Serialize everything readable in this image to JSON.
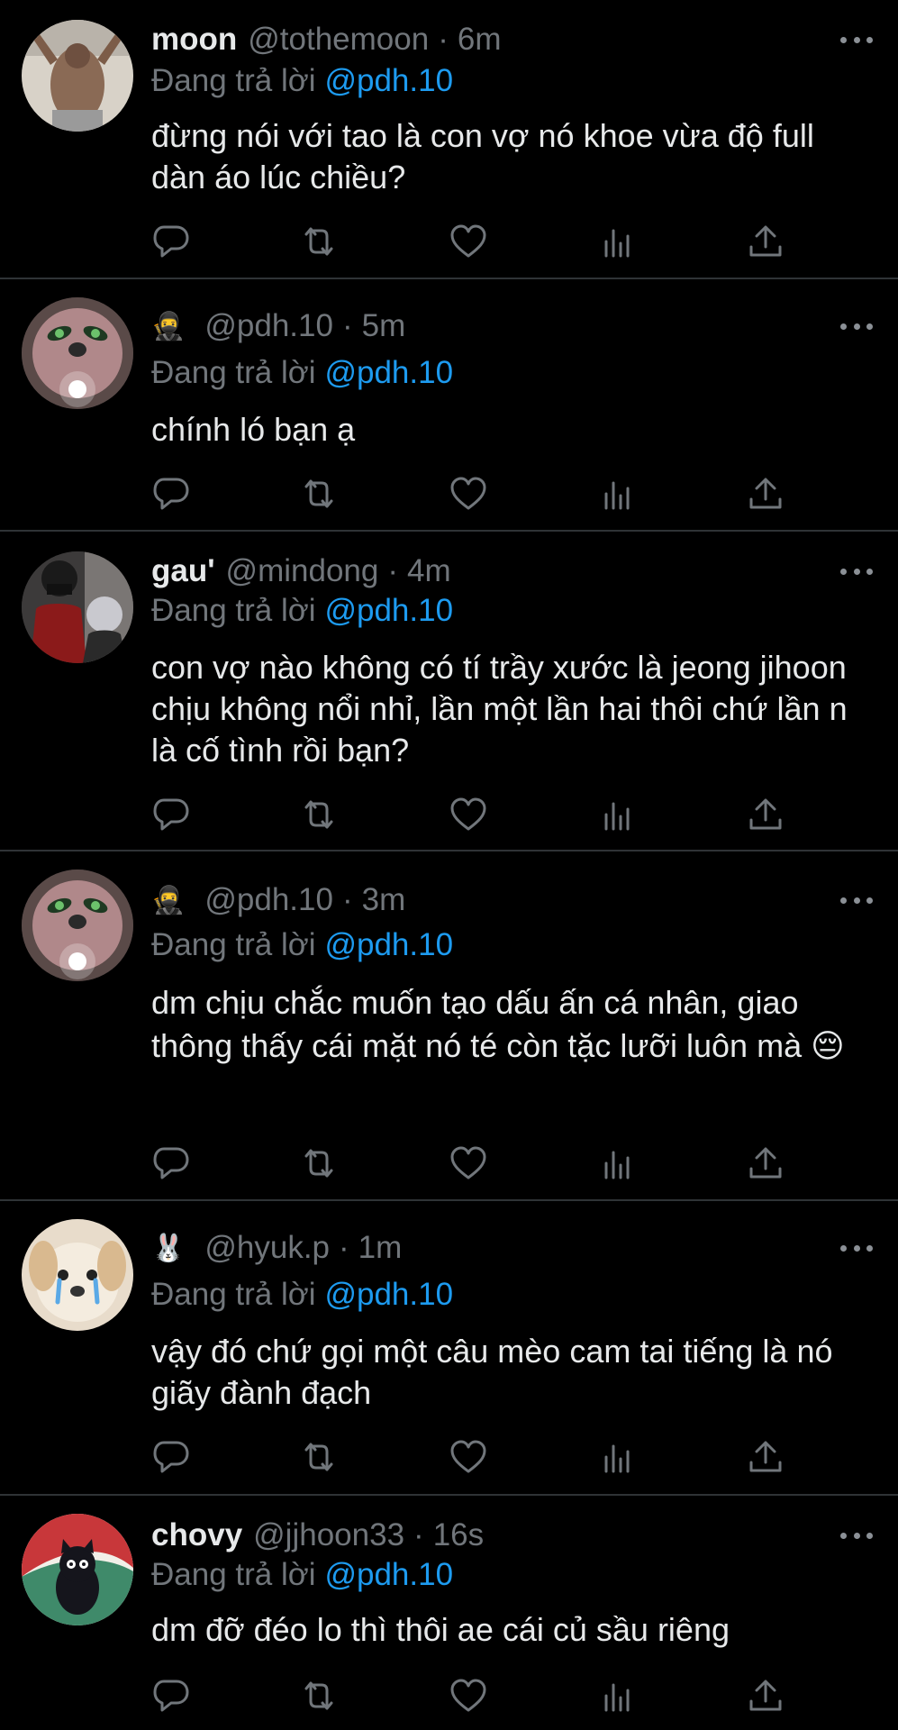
{
  "replying_label": "Đang trả lời",
  "tweets": [
    {
      "name": "moon",
      "emoji": "",
      "handle": "@tothemoon",
      "time": "6m",
      "reply_to": "@pdh.10",
      "text": "đừng nói với tao là con vợ nó khoe vừa độ full dàn áo lúc chiều?",
      "avatar": "gym-photo"
    },
    {
      "name": "",
      "emoji": "🥷",
      "handle": "@pdh.10",
      "time": "5m",
      "reply_to": "@pdh.10",
      "text": "chính ló bạn ạ",
      "avatar": "alien-mask-photo"
    },
    {
      "name": "gau'",
      "emoji": "",
      "handle": "@mindong",
      "time": "4m",
      "reply_to": "@pdh.10",
      "text": "con vợ nào không có tí trầy xước là jeong jihoon chịu không nổi nhỉ, lần một lần hai thôi chứ lần n là cố tình rồi bạn?",
      "avatar": "players-photo"
    },
    {
      "name": "",
      "emoji": "🥷",
      "handle": "@pdh.10",
      "time": "3m",
      "reply_to": "@pdh.10",
      "text": "dm chịu chắc muốn tạo dấu ấn cá nhân, giao thông thấy cái mặt nó té còn tặc lưỡi luôn mà 😔",
      "avatar": "alien-mask-photo"
    },
    {
      "name": "",
      "emoji": "🐰",
      "handle": "@hyuk.p",
      "time": "1m",
      "reply_to": "@pdh.10",
      "text": "vậy đó chứ gọi một câu mèo cam tai tiếng là nó giãy đành đạch",
      "avatar": "crying-puppy"
    },
    {
      "name": "chovy",
      "emoji": "",
      "handle": "@jjhoon33",
      "time": "16s",
      "reply_to": "@pdh.10",
      "text": "dm đỡ đéo lo thì thôi ae cái củ sầu riêng",
      "avatar": "black-cat-illustration"
    }
  ],
  "colors": {
    "background": "#000000",
    "text": "#e7e9ea",
    "muted": "#71767b",
    "mention": "#1d9bf0",
    "divider": "#2f3336"
  },
  "icons": [
    "reply-icon",
    "retweet-icon",
    "like-icon",
    "views-icon",
    "share-icon",
    "more-icon"
  ]
}
